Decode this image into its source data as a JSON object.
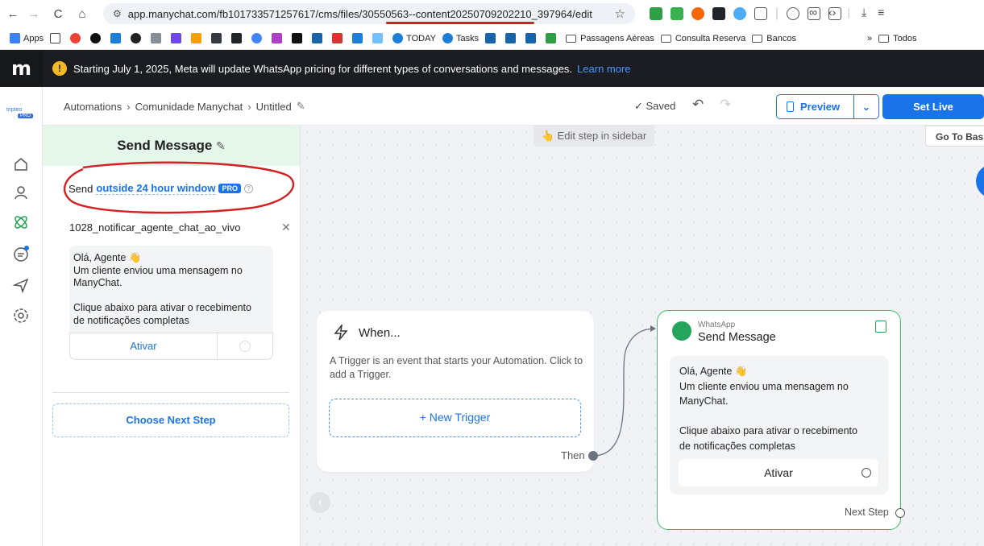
{
  "browser": {
    "url": "app.manychat.com/fb101733571257617/cms/files/30550563--content20250709202210_397964/edit",
    "bookmarks": {
      "apps": "Apps",
      "today": "TODAY",
      "tasks": "Tasks",
      "folders": [
        "Passagens Aéreas",
        "Consulta Reserva",
        "Bancos"
      ],
      "more": "»",
      "all": "Todos"
    }
  },
  "banner": {
    "text": "Starting July 1, 2025, Meta will update WhatsApp pricing for different types of conversations and messages.",
    "link": "Learn more"
  },
  "brand": {
    "name": "tripteo",
    "badge": "PRO"
  },
  "header": {
    "crumbs": [
      "Automations",
      "Comunidade Manychat",
      "Untitled"
    ],
    "saved": "Saved",
    "preview": "Preview",
    "set_live": "Set Live"
  },
  "sidebar": {
    "title": "Send Message",
    "send_prefix": "Send",
    "send_window": "outside 24 hour window",
    "pro_badge": "PRO",
    "template_name": "1028_notificar_agente_chat_ao_vivo",
    "message_lines": [
      "Olá, Agente 👋",
      "Um cliente enviou uma mensagem no",
      "ManyChat.",
      "",
      "Clique abaixo para ativar o recebimento",
      "de notificações completas"
    ],
    "button": "Ativar",
    "choose_next": "Choose Next Step"
  },
  "canvas": {
    "edit_hint": "Edit step in sidebar",
    "go_basic": "Go To Basic",
    "trigger": {
      "title": "When...",
      "desc": "A Trigger is an event that starts your Automation. Click to add a Trigger.",
      "new_trigger": "+ New Trigger",
      "then": "Then"
    },
    "wa_card": {
      "channel": "WhatsApp",
      "title": "Send Message",
      "message_lines": [
        "Olá, Agente 👋",
        "Um cliente enviou uma mensagem no",
        "ManyChat.",
        "",
        "Clique abaixo para ativar o recebimento",
        "de notificações completas"
      ],
      "button": "Ativar",
      "next_step": "Next Step"
    }
  },
  "colors": {
    "accent": "#1a73e8",
    "whatsapp": "#25a55b",
    "annotation": "#d42020",
    "banner": "#1b1d22"
  }
}
